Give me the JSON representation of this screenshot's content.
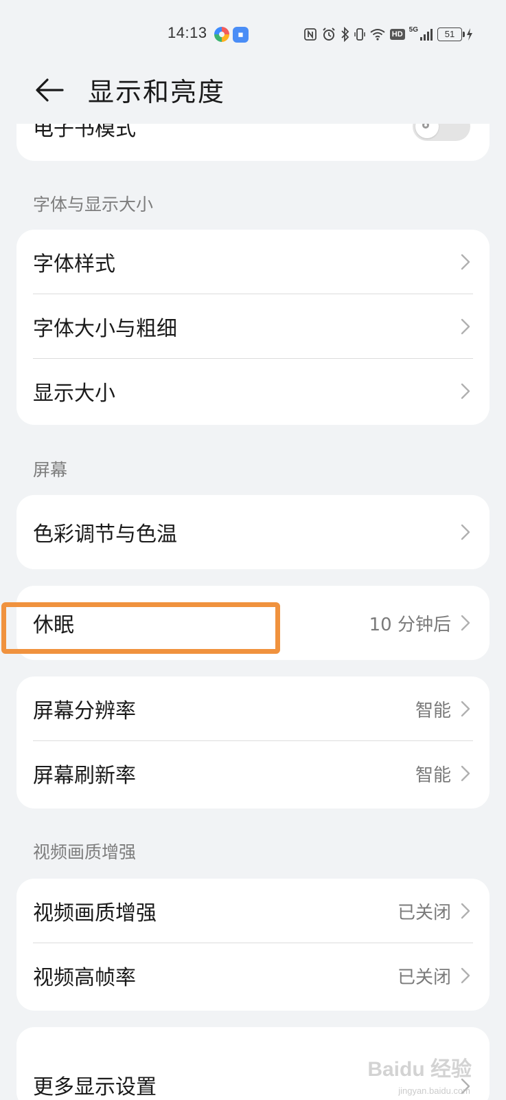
{
  "status_bar": {
    "time": "14:13",
    "hd_label": "HD",
    "network_label": "5G",
    "battery_level": "51"
  },
  "header": {
    "title": "显示和亮度"
  },
  "top_card": {
    "label": "电子书模式",
    "toggle_on": false
  },
  "font_section": {
    "title": "字体与显示大小",
    "items": [
      {
        "label": "字体样式",
        "value": ""
      },
      {
        "label": "字体大小与粗细",
        "value": ""
      },
      {
        "label": "显示大小",
        "value": ""
      }
    ]
  },
  "screen_section": {
    "title": "屏幕",
    "color_item": {
      "label": "色彩调节与色温",
      "value": ""
    },
    "sleep_item": {
      "label": "休眠",
      "value": "10 分钟后"
    },
    "resolution_items": [
      {
        "label": "屏幕分辨率",
        "value": "智能"
      },
      {
        "label": "屏幕刷新率",
        "value": "智能"
      }
    ]
  },
  "video_section": {
    "title": "视频画质增强",
    "items": [
      {
        "label": "视频画质增强",
        "value": "已关闭"
      },
      {
        "label": "视频高帧率",
        "value": "已关闭"
      }
    ]
  },
  "more_item": {
    "label": "更多显示设置"
  },
  "watermark": {
    "text": "Baidu 经验",
    "sub": "jingyan.baidu.com"
  },
  "colors": {
    "background": "#f1f3f5",
    "card": "#ffffff",
    "highlight": "#f0923e"
  }
}
